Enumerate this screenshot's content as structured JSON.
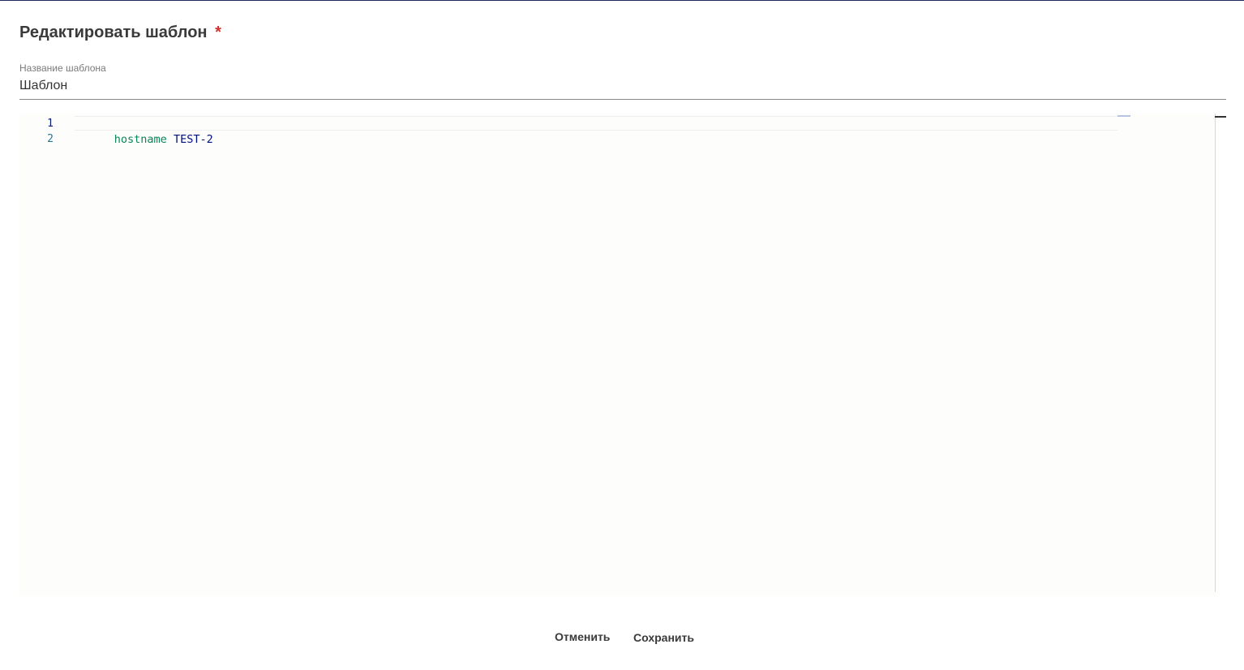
{
  "dialog": {
    "title": "Редактировать шаблон",
    "required_marker": "*"
  },
  "name_field": {
    "label": "Название шаблона",
    "value": "Шаблон"
  },
  "editor": {
    "lines": [
      {
        "number": "1",
        "tokens": [
          {
            "text": "hostname",
            "type": "keyword"
          },
          {
            "text": " ",
            "type": "space"
          },
          {
            "text": "TEST-2",
            "type": "value"
          }
        ]
      },
      {
        "number": "2",
        "tokens": []
      }
    ]
  },
  "actions": {
    "cancel_label": "Отменить",
    "save_label": "Сохранить"
  },
  "colors": {
    "required": "#d32f2f",
    "keyword": "#098658",
    "value": "#001080",
    "active_line_number": "#0b216f",
    "line_number": "#237893"
  }
}
